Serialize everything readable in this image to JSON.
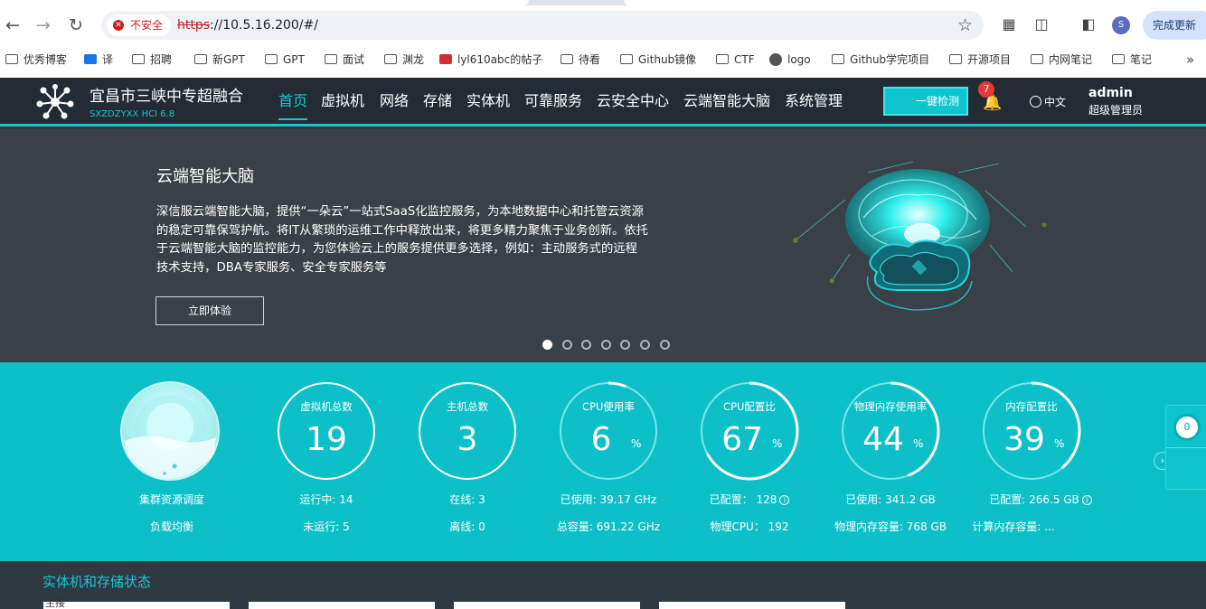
{
  "browser": {
    "security_label": "不安全",
    "url_scheme": "https",
    "url_rest": "://10.5.16.200/#/",
    "update_label": "完成更新",
    "profile_initial": "S",
    "bookmarks": [
      "优秀博客",
      "译",
      "招聘",
      "新GPT",
      "GPT",
      "面试",
      "渊龙",
      "lyl610abc的帖子",
      "待看",
      "Github镜像",
      "CTF",
      "logo",
      "Github学完项目",
      "开源项目",
      "内网笔记",
      "笔记"
    ]
  },
  "header": {
    "brand": "宜昌市三峡中专超融合",
    "brand_sub": "SXZDZYXX HCI 6.8",
    "menu": [
      "首页",
      "虚拟机",
      "网络",
      "存储",
      "实体机",
      "可靠服务",
      "云安全中心",
      "云端智能大脑",
      "系统管理"
    ],
    "active_menu": "首页",
    "check_label": "一键检测",
    "notification_count": "7",
    "language": "中文",
    "user_name": "admin",
    "user_role": "超级管理员"
  },
  "banner": {
    "title": "云端智能大脑",
    "description": "深信服云端智能大脑，提供“一朵云”一站式SaaS化监控服务，为本地数据中心和托管云资源的稳定可靠保驾护航。将IT从繁琐的运维工作中释放出来，将更多精力聚焦于业务创新。依托于云端智能大脑的监控能力，为您体验云上的服务提供更多选择，例如：主动服务式的远程技术支持，DBA专家服务、安全专家服务等",
    "button_label": "立即体验",
    "slides_total": 7,
    "active_slide": 1
  },
  "stats": {
    "cluster": {
      "label1": "集群资源调度",
      "label2": "负载均衡"
    },
    "vm": {
      "title": "虚拟机总数",
      "value": "19",
      "line1": "运行中: 14",
      "line2": "未运行: 5"
    },
    "host": {
      "title": "主机总数",
      "value": "3",
      "line1": "在线: 3",
      "line2": "离线: 0"
    },
    "cpu_usage": {
      "title": "CPU使用率",
      "value": "6",
      "unit": "%",
      "line1": "已使用: 39.17 GHz",
      "line2": "总容量: 691.22 GHz",
      "percent": 6
    },
    "cpu_ratio": {
      "title": "CPU配置比",
      "value": "67",
      "unit": "%",
      "line1": "已配置： 128",
      "line2": "物理CPU： 192",
      "percent": 67
    },
    "mem_usage": {
      "title": "物理内存使用率",
      "value": "44",
      "unit": "%",
      "line1": "已使用: 341.2 GB",
      "line2": "物理内存容量: 768 GB",
      "percent": 44
    },
    "mem_ratio": {
      "title": "内存配置比",
      "value": "39",
      "unit": "%",
      "line1": "已配置: 266.5 GB",
      "line2": "计算内存容量: ...",
      "percent": 39
    },
    "float_value": "0"
  },
  "bottom": {
    "section_title": "实体机和存储状态",
    "first_card_tab": "主接"
  }
}
